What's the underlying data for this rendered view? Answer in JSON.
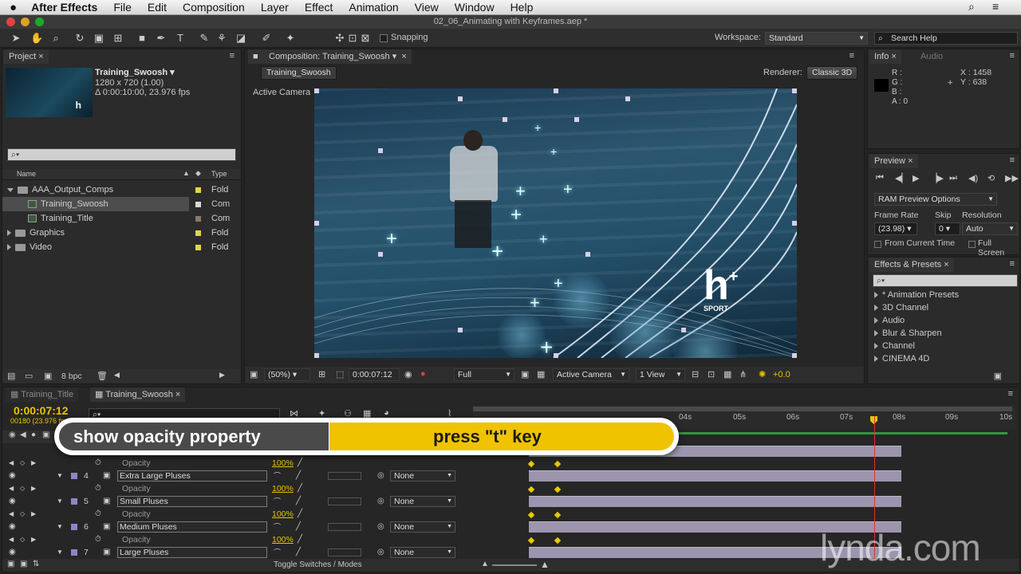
{
  "menubar": {
    "app": "After Effects",
    "items": [
      "File",
      "Edit",
      "Composition",
      "Layer",
      "Effect",
      "Animation",
      "View",
      "Window",
      "Help"
    ]
  },
  "window_title": "02_06_Animating with Keyframes.aep *",
  "toolbar": {
    "snapping": "Snapping",
    "workspace_label": "Workspace:",
    "workspace_value": "Standard",
    "search_help": "Search Help"
  },
  "project": {
    "tab": "Project",
    "selected_name": "Training_Swoosh ▾",
    "size": "1280 x 720 (1.00)",
    "duration": "Δ 0:00:10:00, 23.976 fps",
    "col_name": "Name",
    "col_type": "Type",
    "items": [
      {
        "name": "AAA_Output_Comps",
        "type": "Fold",
        "color": "#e5d44a"
      },
      {
        "name": "Training_Swoosh",
        "type": "Com",
        "color": "#d8d8d8"
      },
      {
        "name": "Training_Title",
        "type": "Com",
        "color": "#8a7a66"
      },
      {
        "name": "Graphics",
        "type": "Fold",
        "color": "#e5d44a"
      },
      {
        "name": "Video",
        "type": "Fold",
        "color": "#e5d44a"
      }
    ],
    "bpc": "8 bpc"
  },
  "composition": {
    "tab": "Composition: Training_Swoosh",
    "sub_tab": "Training_Swoosh",
    "renderer_label": "Renderer:",
    "renderer_value": "Classic 3D",
    "view_label": "Active Camera",
    "logo_h": "h",
    "logo_plus": "+",
    "logo_sport": "SPORT",
    "footer": {
      "zoom": "(50%)",
      "timecode": "0:00:07:12",
      "resolution": "Full",
      "camera": "Active Camera",
      "views": "1 View",
      "exposure": "+0.0"
    }
  },
  "info": {
    "tab": "Info",
    "tab2": "Audio",
    "r": "R :",
    "g": "G :",
    "b": "B :",
    "a": "A : 0",
    "x": "X : 1458",
    "y": "Y : 638"
  },
  "preview": {
    "tab": "Preview",
    "ram_options": "RAM Preview Options",
    "frame_rate_label": "Frame Rate",
    "skip_label": "Skip",
    "resolution_label": "Resolution",
    "frame_rate": "(23.98)",
    "skip": "0",
    "resolution": "Auto",
    "from_current": "From Current Time",
    "full_screen": "Full Screen"
  },
  "effects": {
    "tab": "Effects & Presets",
    "items": [
      "* Animation Presets",
      "3D Channel",
      "Audio",
      "Blur & Sharpen",
      "Channel",
      "CINEMA 4D"
    ]
  },
  "timeline": {
    "tab1": "Training_Title",
    "tab2": "Training_Swoosh",
    "timecode": "0:00:07:12",
    "frames": "00180 (23.976 fps)",
    "ruler": [
      "04s",
      "05s",
      "06s",
      "07s",
      "08s",
      "09s",
      "10s"
    ],
    "layers": [
      {
        "num": "",
        "name": "Opacity",
        "value": "100%",
        "prop": true
      },
      {
        "num": "4",
        "name": "Extra Large Pluses",
        "parent": "None",
        "prop": false
      },
      {
        "num": "",
        "name": "Opacity",
        "value": "100%",
        "prop": true
      },
      {
        "num": "5",
        "name": "Small Pluses",
        "parent": "None",
        "prop": false
      },
      {
        "num": "",
        "name": "Opacity",
        "value": "100%",
        "prop": true
      },
      {
        "num": "6",
        "name": "Medium Pluses",
        "parent": "None",
        "prop": false
      },
      {
        "num": "",
        "name": "Opacity",
        "value": "100%",
        "prop": true
      },
      {
        "num": "7",
        "name": "Large Pluses",
        "parent": "None",
        "prop": false
      }
    ],
    "toggle": "Toggle Switches / Modes"
  },
  "overlay": {
    "left": "show opacity property",
    "right": "press \"t\" key"
  },
  "watermark": "lynda.com",
  "colors": {
    "accent": "#e5c400",
    "timecode": "#e8c300",
    "bar": "#9c95ad"
  }
}
